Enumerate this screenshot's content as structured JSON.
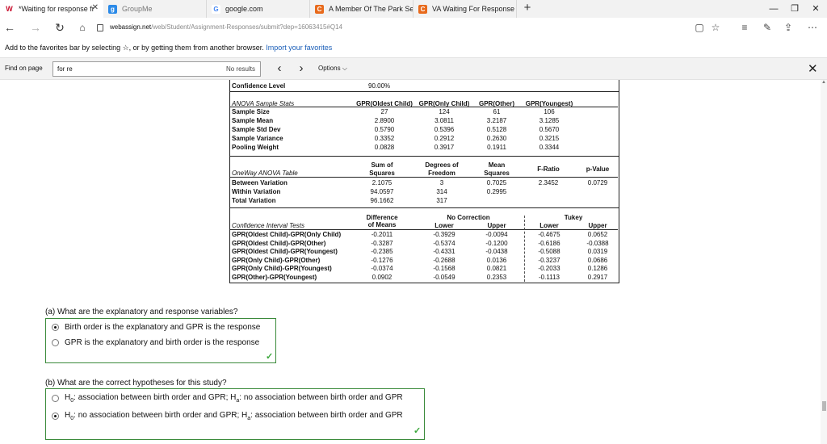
{
  "browser": {
    "tabs": [
      {
        "title": "*Waiting for response fr",
        "icon": "webassign-icon",
        "active": true
      },
      {
        "title": "GroupMe",
        "icon": "groupme-icon"
      },
      {
        "title": "google.com",
        "icon": "google-icon"
      },
      {
        "title": "A Member Of The Park Serv",
        "icon": "chegg-icon"
      },
      {
        "title": "VA Waiting For Response Fr",
        "icon": "chegg-icon"
      }
    ],
    "new_tab": "+",
    "window_controls": [
      "—",
      "❐",
      "✕"
    ],
    "address": {
      "host": "webassign.net",
      "path": "/web/Student/Assignment-Responses/submit?dep=16063415#Q14"
    },
    "favorites_msg": "Add to the favorites bar by selecting ☆, or by getting them from another browser.",
    "import_link": "Import your favorites",
    "find": {
      "label": "Find on page",
      "value": "for re",
      "results": "No results",
      "options_label": "Options"
    }
  },
  "stats": {
    "confidence_label": "Confidence Level",
    "confidence_value": "90.00%",
    "anova_title": "ANOVA Sample Stats",
    "groups": [
      "GPR(Oldest Child)",
      "GPR(Only Child)",
      "GPR(Other)",
      "GPR(Youngest)"
    ],
    "rows": [
      {
        "label": "Sample Size",
        "values": [
          "27",
          "124",
          "61",
          "106"
        ]
      },
      {
        "label": "Sample Mean",
        "values": [
          "2.8900",
          "3.0811",
          "3.2187",
          "3.1285"
        ]
      },
      {
        "label": "Sample Std Dev",
        "values": [
          "0.5790",
          "0.5396",
          "0.5128",
          "0.5670"
        ]
      },
      {
        "label": "Sample Variance",
        "values": [
          "0.3352",
          "0.2912",
          "0.2630",
          "0.3215"
        ]
      },
      {
        "label": "Pooling Weight",
        "values": [
          "0.0828",
          "0.3917",
          "0.1911",
          "0.3344"
        ]
      }
    ],
    "oneway_title": "OneWay ANOVA Table",
    "oneway_headers": {
      "ss": [
        "Sum of",
        "Squares"
      ],
      "df": [
        "Degrees of",
        "Freedom"
      ],
      "ms": [
        "Mean",
        "Squares"
      ],
      "f": "F-Ratio",
      "p": "p-Value"
    },
    "oneway_rows": [
      {
        "label": "Between Variation",
        "ss": "2.1075",
        "df": "3",
        "ms": "0.7025",
        "f": "2.3452",
        "p": "0.0729"
      },
      {
        "label": "Within Variation",
        "ss": "94.0597",
        "df": "314",
        "ms": "0.2995",
        "f": "",
        "p": ""
      },
      {
        "label": "Total Variation",
        "ss": "96.1662",
        "df": "317",
        "ms": "",
        "f": "",
        "p": ""
      }
    ],
    "ci_title": "Confidence Interval Tests",
    "ci_headers": {
      "diff": [
        "Difference",
        "of Means"
      ],
      "nc": "No Correction",
      "tukey": "Tukey",
      "lower": "Lower",
      "upper": "Upper"
    },
    "ci_rows": [
      {
        "label": "GPR(Oldest Child)-GPR(Only Child)",
        "diff": "-0.2011",
        "nl": "-0.3929",
        "nu": "-0.0094",
        "tl": "-0.4675",
        "tu": "0.0652"
      },
      {
        "label": "GPR(Oldest Child)-GPR(Other)",
        "diff": "-0.3287",
        "nl": "-0.5374",
        "nu": "-0.1200",
        "tl": "-0.6186",
        "tu": "-0.0388"
      },
      {
        "label": "GPR(Oldest Child)-GPR(Youngest)",
        "diff": "-0.2385",
        "nl": "-0.4331",
        "nu": "-0.0438",
        "tl": "-0.5088",
        "tu": "0.0319"
      },
      {
        "label": "GPR(Only Child)-GPR(Other)",
        "diff": "-0.1276",
        "nl": "-0.2688",
        "nu": "0.0136",
        "tl": "-0.3237",
        "tu": "0.0686"
      },
      {
        "label": "GPR(Only Child)-GPR(Youngest)",
        "diff": "-0.0374",
        "nl": "-0.1568",
        "nu": "0.0821",
        "tl": "-0.2033",
        "tu": "0.1286"
      },
      {
        "label": "GPR(Other)-GPR(Youngest)",
        "diff": "0.0902",
        "nl": "-0.0549",
        "nu": "0.2353",
        "tl": "-0.1113",
        "tu": "0.2917"
      }
    ]
  },
  "questions": {
    "a": {
      "prompt": "(a) What are the explanatory and response variables?",
      "options": [
        "Birth order is the explanatory and GPR is the response",
        "GPR is the explanatory and birth order is the response"
      ],
      "selected": 0
    },
    "b": {
      "prompt": "(b) What are the correct hypotheses for this study?",
      "options": [
        {
          "h0": "H",
          "h0sub": "0",
          "h0text": ": association between birth order and GPR; H",
          "hasub": "a",
          "hatext": ": no association between birth order and GPR"
        },
        {
          "h0": "H",
          "h0sub": "0",
          "h0text": ": no association between birth order and GPR; H",
          "hasub": "a",
          "hatext": ": association between birth order and GPR"
        }
      ],
      "selected": 1
    },
    "check_mark": "✓"
  },
  "colors": {
    "accent": "#1a5eb8",
    "correct": "#3aa63a"
  }
}
